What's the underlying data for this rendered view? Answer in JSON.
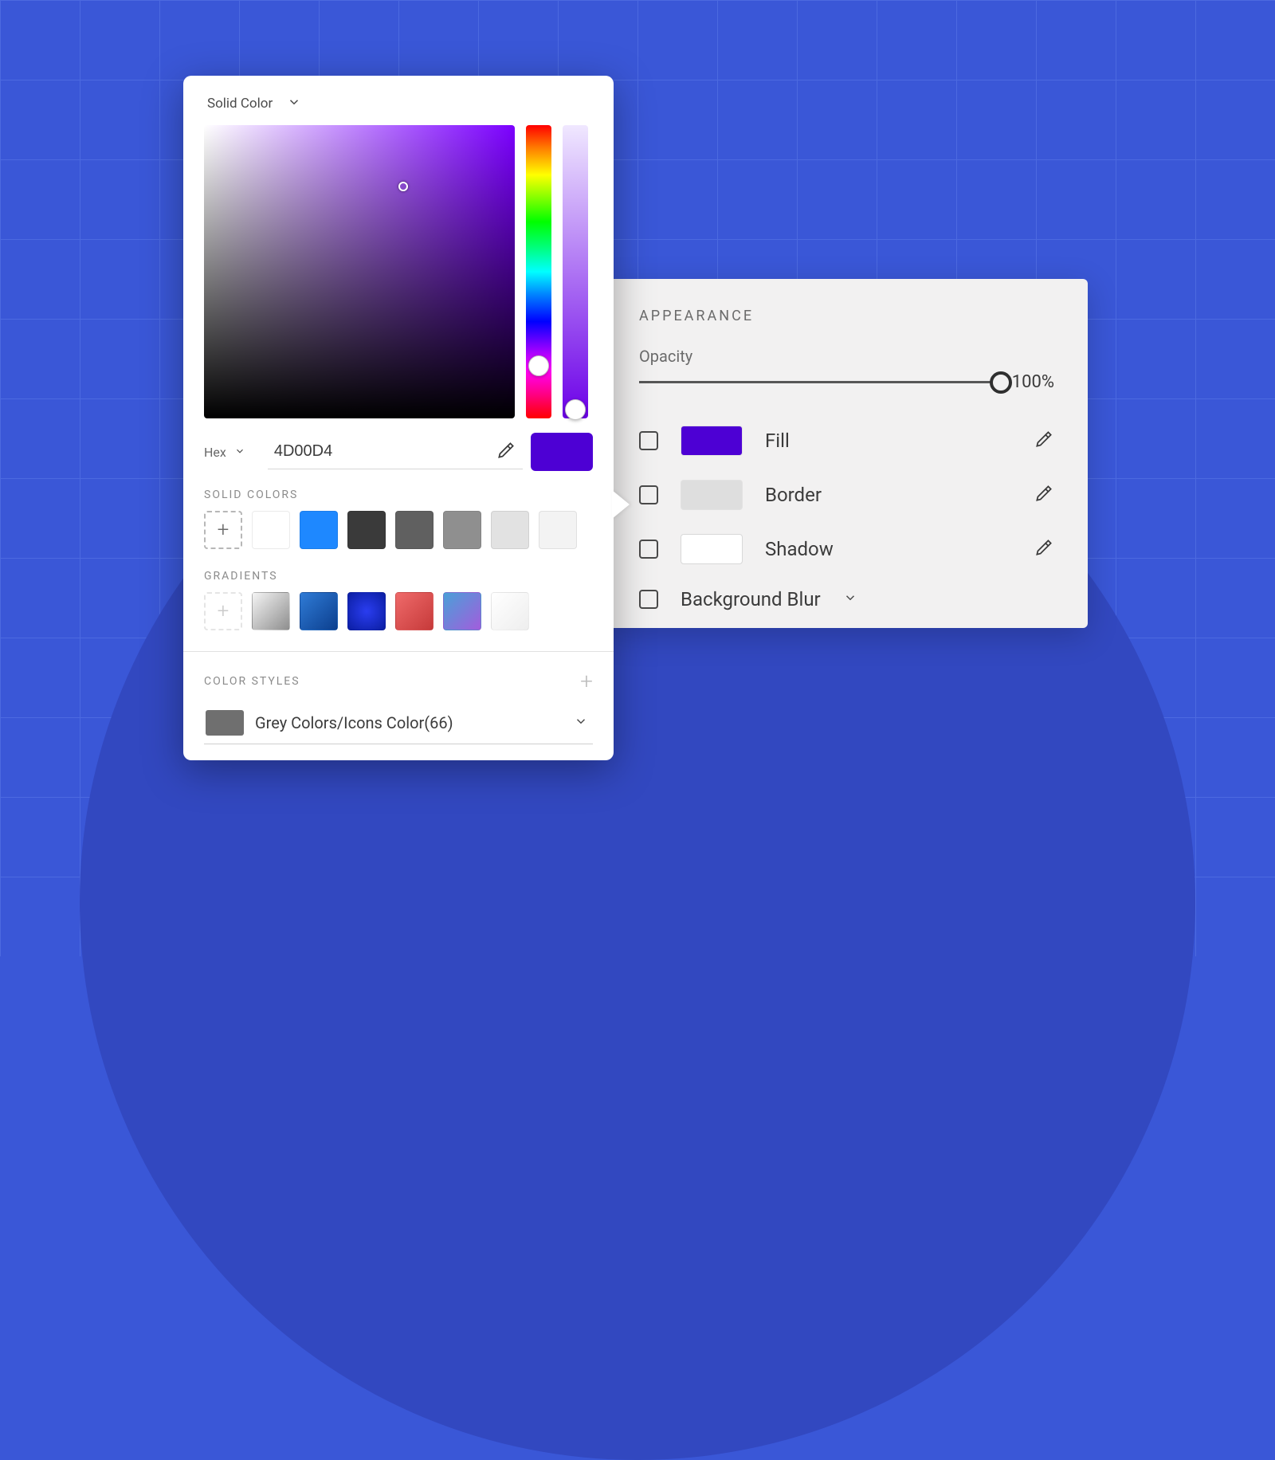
{
  "appearance": {
    "title": "APPEARANCE",
    "opacity_label": "Opacity",
    "opacity_value": "100%",
    "props": [
      {
        "label": "Fill",
        "swatch": "#4D00D4"
      },
      {
        "label": "Border",
        "swatch": "#dedede"
      },
      {
        "label": "Shadow",
        "swatch": "#ffffff"
      }
    ],
    "bg_blur_label": "Background Blur"
  },
  "picker": {
    "mode_label": "Solid Color",
    "hex_format_label": "Hex",
    "hex_value": "4D00D4",
    "current_color": "#4D00D4",
    "solid_colors_label": "SOLID COLORS",
    "solid_colors": [
      "#ffffff",
      "#1e88ff",
      "#3a3a3a",
      "#606060",
      "#8f8f8f",
      "#e2e2e2",
      "#f3f3f3"
    ],
    "gradients_label": "GRADIENTS",
    "gradients": [
      "linear-gradient(135deg,#f4f4f4,#8e8e8e)",
      "linear-gradient(135deg,#2f7bd6,#0c3f8e)",
      "radial-gradient(circle at 50% 50%, #2a3df0, #0b1ea2)",
      "linear-gradient(135deg,#ef6a6a,#c63a3a)",
      "linear-gradient(135deg,#4aa0d8,#a25ddc)",
      "linear-gradient(135deg,#ffffff,#eeeeee)"
    ],
    "color_styles_label": "COLOR STYLES",
    "selected_style_swatch": "#6f6f6f",
    "selected_style_name": "Grey Colors/Icons Color(66)"
  }
}
